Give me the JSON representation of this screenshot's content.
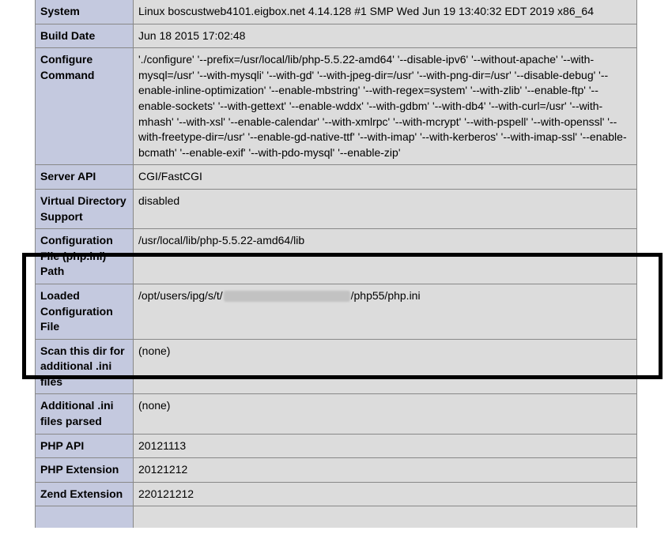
{
  "rows": {
    "system": {
      "label": "System",
      "value": "Linux boscustweb4101.eigbox.net 4.14.128 #1 SMP Wed Jun 19 13:40:32 EDT 2019 x86_64"
    },
    "build_date": {
      "label": "Build Date",
      "value": "Jun 18 2015 17:02:48"
    },
    "configure_command": {
      "label": "Configure Command",
      "value": "'./configure' '--prefix=/usr/local/lib/php-5.5.22-amd64' '--disable-ipv6' '--without-apache' '--with-mysql=/usr' '--with-mysqli' '--with-gd' '--with-jpeg-dir=/usr' '--with-png-dir=/usr' '--disable-debug' '--enable-inline-optimization' '--enable-mbstring' '--with-regex=system' '--with-zlib' '--enable-ftp' '--enable-sockets' '--with-gettext' '--enable-wddx' '--with-gdbm' '--with-db4' '--with-curl=/usr' '--with-mhash' '--with-xsl' '--enable-calendar' '--with-xmlrpc' '--with-mcrypt' '--with-pspell' '--with-openssl' '--with-freetype-dir=/usr' '--enable-gd-native-ttf' '--with-imap' '--with-kerberos' '--with-imap-ssl' '--enable-bcmath' '--enable-exif' '--with-pdo-mysql' '--enable-zip'"
    },
    "server_api": {
      "label": "Server API",
      "value": "CGI/FastCGI"
    },
    "virtual_directory_support": {
      "label": "Virtual Directory Support",
      "value": "disabled"
    },
    "config_file_path": {
      "label": "Configuration File (php.ini) Path",
      "value": "/usr/local/lib/php-5.5.22-amd64/lib"
    },
    "loaded_config_file": {
      "label": "Loaded Configuration File",
      "value_prefix": "/opt/users/ipg/s/t/",
      "value_suffix": "/php55/php.ini"
    },
    "scan_dir": {
      "label": "Scan this dir for additional .ini files",
      "value": "(none)"
    },
    "additional_ini": {
      "label": "Additional .ini files parsed",
      "value": "(none)"
    },
    "php_api": {
      "label": "PHP API",
      "value": "20121113"
    },
    "php_extension": {
      "label": "PHP Extension",
      "value": "20121212"
    },
    "zend_extension": {
      "label": "Zend Extension",
      "value": "220121212"
    }
  }
}
